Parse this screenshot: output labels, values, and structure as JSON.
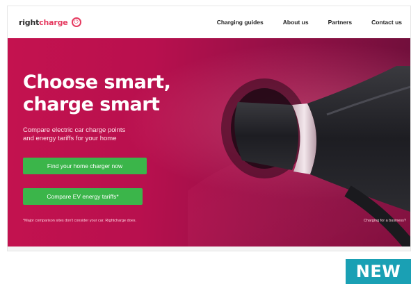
{
  "header": {
    "logo_main": "right",
    "logo_accent": "charge",
    "logo_icon": "power-plug-icon",
    "nav": [
      {
        "label": "Charging guides"
      },
      {
        "label": "About us"
      },
      {
        "label": "Partners"
      },
      {
        "label": "Contact us"
      }
    ]
  },
  "hero": {
    "headline_line1": "Choose smart,",
    "headline_line2": "charge smart",
    "subtext_line1": "Compare electric car charge points",
    "subtext_line2": "and energy tariffs for your home",
    "cta_primary": "Find your home charger now",
    "cta_secondary": "Compare EV energy tariffs*",
    "footnote": "*Major comparison sites don't consider your car. Rightcharge does.",
    "footnote_right": "Charging for a business?"
  },
  "badge": {
    "label": "NEW"
  },
  "colors": {
    "brand_pink": "#e5395f",
    "hero_magenta": "#b8104e",
    "cta_green": "#3bb54a",
    "badge_teal": "#1aa0b4"
  }
}
